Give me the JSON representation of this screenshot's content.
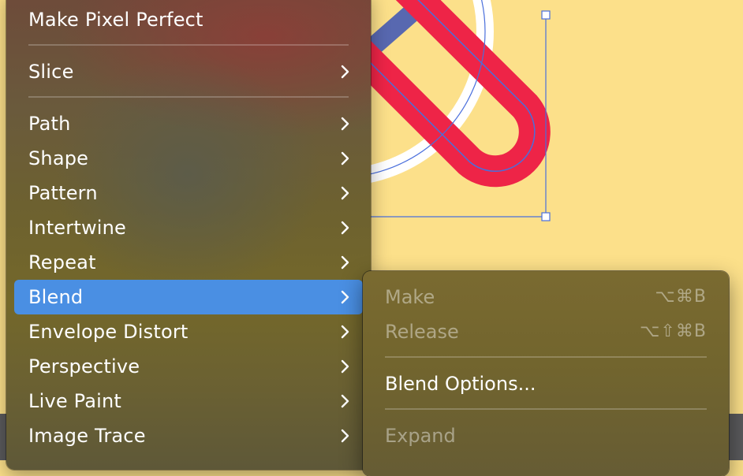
{
  "colors": {
    "canvas_background": "#fce08a",
    "stripe_red": "#ee2447",
    "stripe_blue": "#5868b0",
    "ring_white": "#ffffff",
    "selection_blue": "#4a6fdc",
    "menu_highlight": "#4a8fe3"
  },
  "main_menu": {
    "items": [
      {
        "label": "Make Pixel Perfect",
        "submenu": false
      },
      {
        "label": "Slice",
        "submenu": true
      },
      {
        "label": "Path",
        "submenu": true
      },
      {
        "label": "Shape",
        "submenu": true
      },
      {
        "label": "Pattern",
        "submenu": true
      },
      {
        "label": "Intertwine",
        "submenu": true
      },
      {
        "label": "Repeat",
        "submenu": true
      },
      {
        "label": "Blend",
        "submenu": true,
        "highlighted": true
      },
      {
        "label": "Envelope Distort",
        "submenu": true
      },
      {
        "label": "Perspective",
        "submenu": true
      },
      {
        "label": "Live Paint",
        "submenu": true
      },
      {
        "label": "Image Trace",
        "submenu": true
      }
    ]
  },
  "blend_submenu": {
    "items": [
      {
        "label": "Make",
        "shortcut": "⌥⌘B",
        "enabled": false
      },
      {
        "label": "Release",
        "shortcut": "⌥⇧⌘B",
        "enabled": false
      },
      {
        "label": "Blend Options...",
        "shortcut": "",
        "enabled": true
      },
      {
        "label": "Expand",
        "shortcut": "",
        "enabled": false
      }
    ]
  }
}
